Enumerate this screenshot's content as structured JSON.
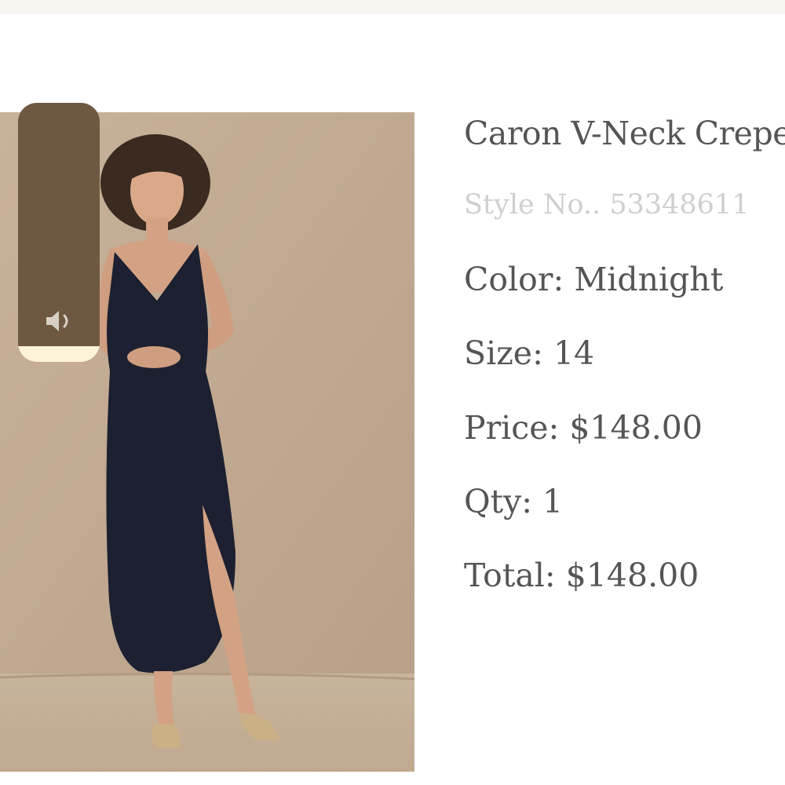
{
  "product": {
    "title": "Caron V-Neck Crepe",
    "style_label": "Style No..",
    "style_number": "53348611",
    "color_label": "Color:",
    "color_value": "Midnight",
    "size_label": "Size:",
    "size_value": "14",
    "price_label": "Price:",
    "price_value": "$148.00",
    "qty_label": "Qty:",
    "qty_value": "1",
    "total_label": "Total:",
    "total_value": "$148.00"
  },
  "volume_hud": {
    "icon": "speaker-icon",
    "level": 0.06
  },
  "colors": {
    "text": "#555555",
    "muted_text": "#cfcfcf",
    "hud_background": "#6e5841",
    "hud_fill": "#fdf3d8",
    "photo_backdrop": "#c5ad93",
    "dress": "#1c2030"
  }
}
